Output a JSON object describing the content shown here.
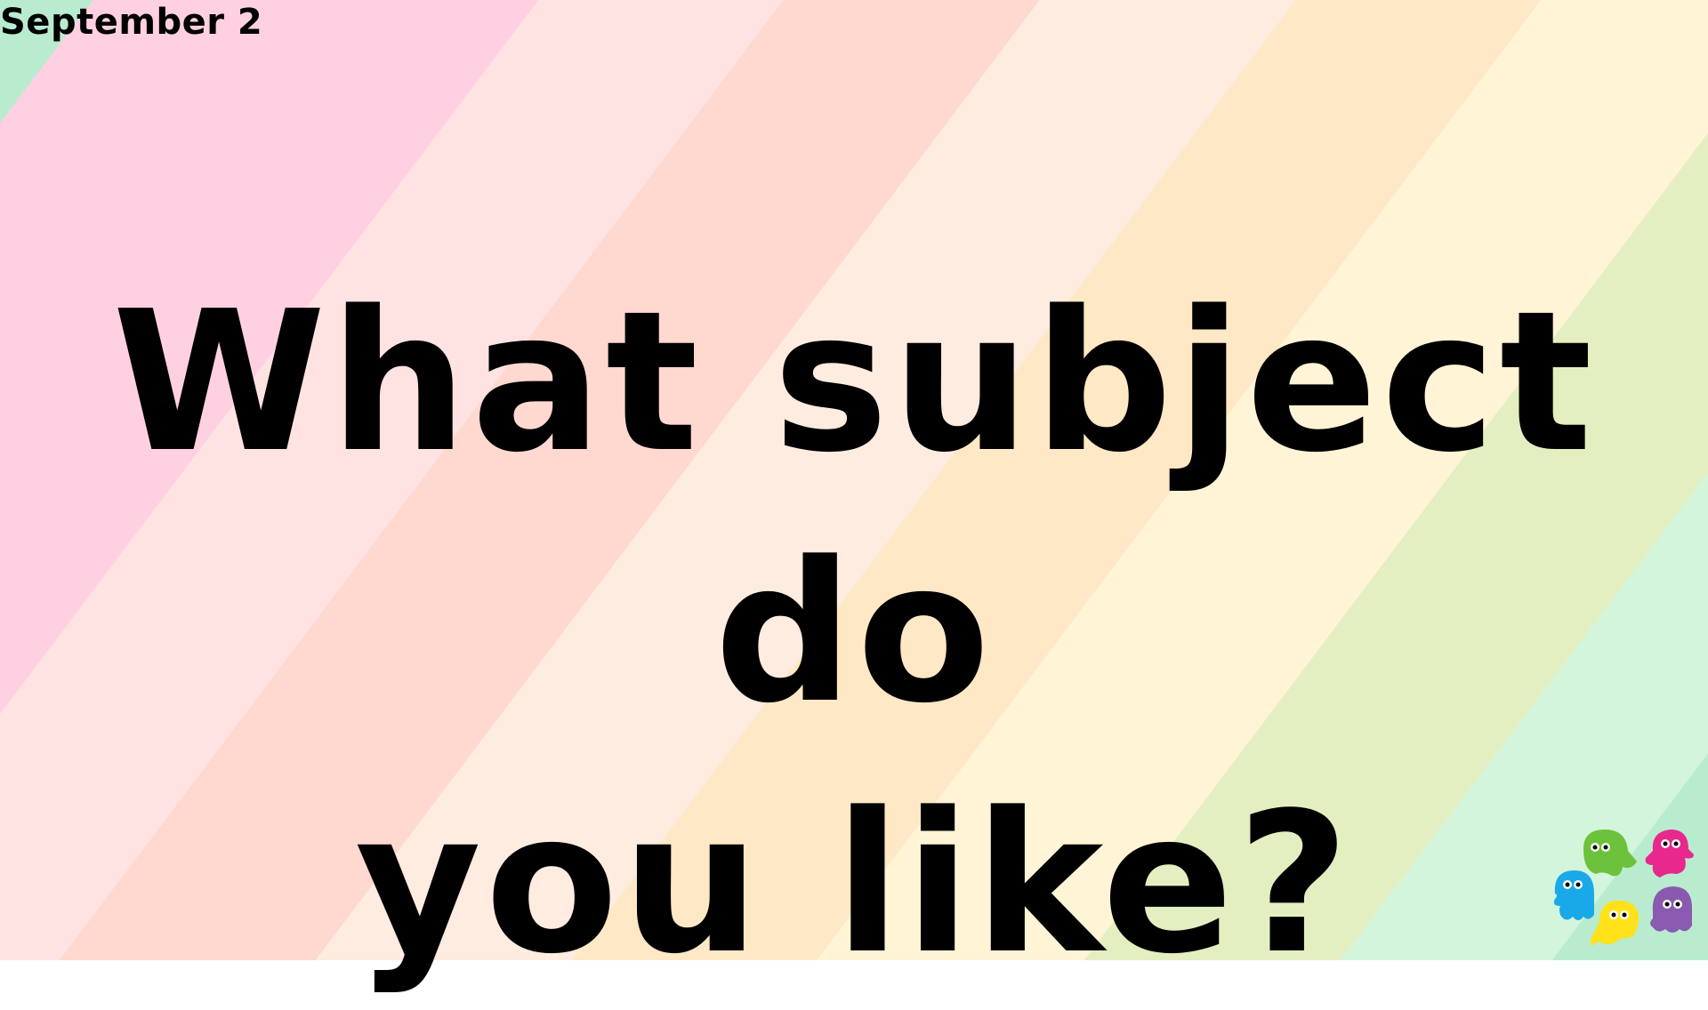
{
  "date_label": "September 2",
  "question": {
    "line1": "What subject do",
    "line2": "you like?"
  },
  "decoration": {
    "ghost_colors": [
      "#6cc23a",
      "#e8288c",
      "#1aa9e8",
      "#ffe21a",
      "#8a5ab0"
    ]
  }
}
